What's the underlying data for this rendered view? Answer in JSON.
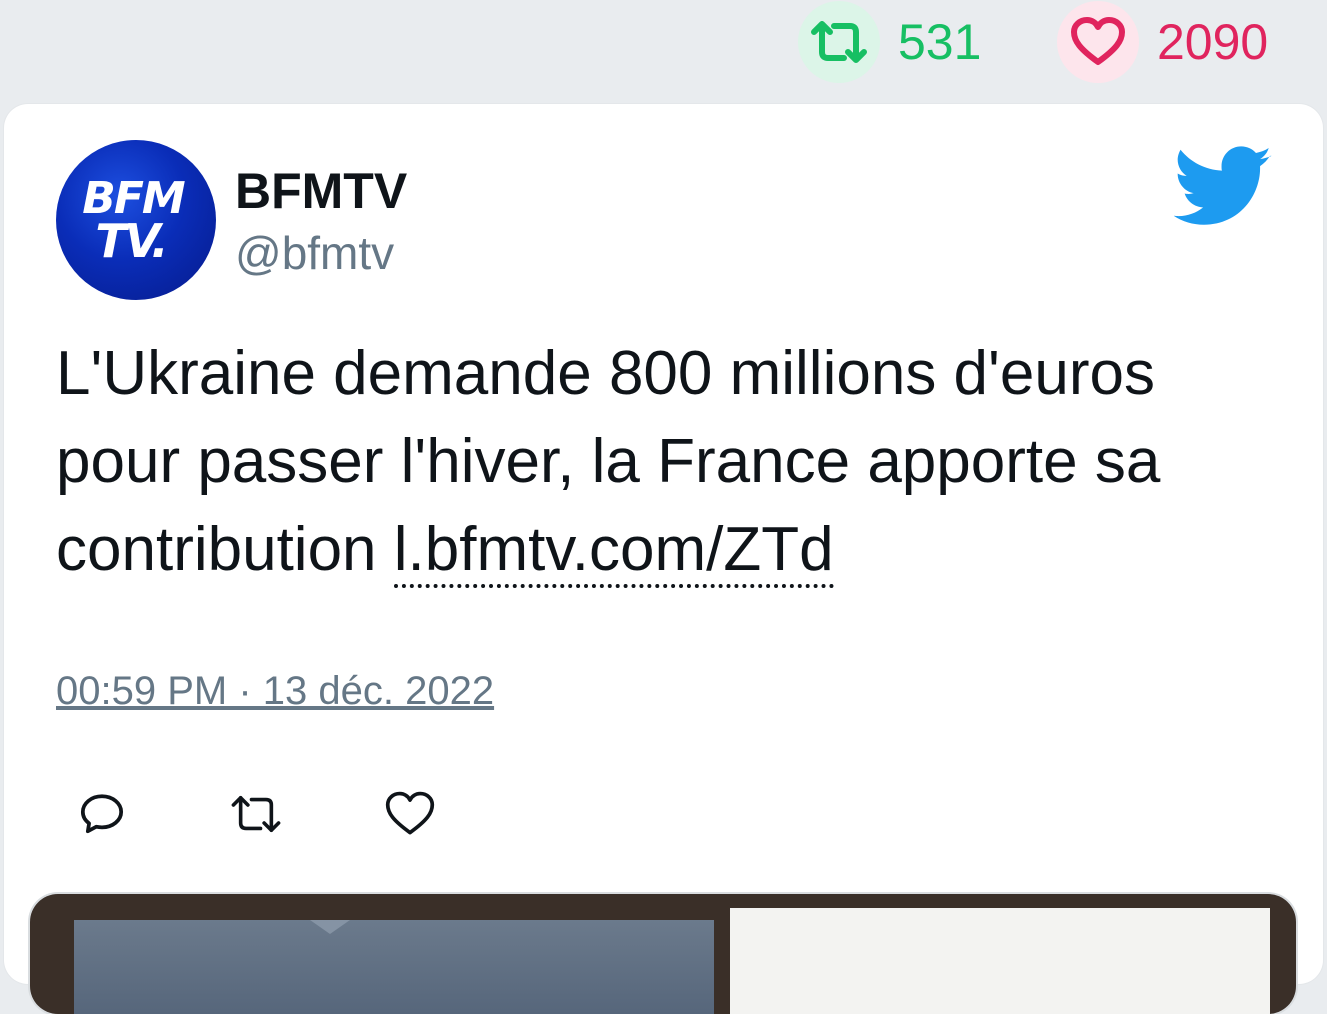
{
  "stats": {
    "retweets": "531",
    "likes": "2090"
  },
  "tweet": {
    "avatar_logo_line1": "BFM",
    "avatar_logo_line2": "TV.",
    "author_name": "BFMTV",
    "author_handle": "@bfmtv",
    "text_body": "L'Ukraine demande 800 millions d'euros pour passer l'hiver, la France apporte sa contribution ",
    "link_text": "l.bfmtv.com/ZTd",
    "timestamp": "00:59 PM · 13 déc. 2022"
  },
  "colors": {
    "retweet_green": "#17bf63",
    "like_red": "#e0245e",
    "twitter_blue": "#1d9bf0",
    "muted_gray": "#657786"
  },
  "icons": {
    "retweet_stat": "retweet-icon",
    "like_stat": "heart-icon",
    "brand": "twitter-bird-icon",
    "reply_action": "reply-icon",
    "retweet_action": "retweet-icon",
    "like_action": "heart-icon"
  }
}
